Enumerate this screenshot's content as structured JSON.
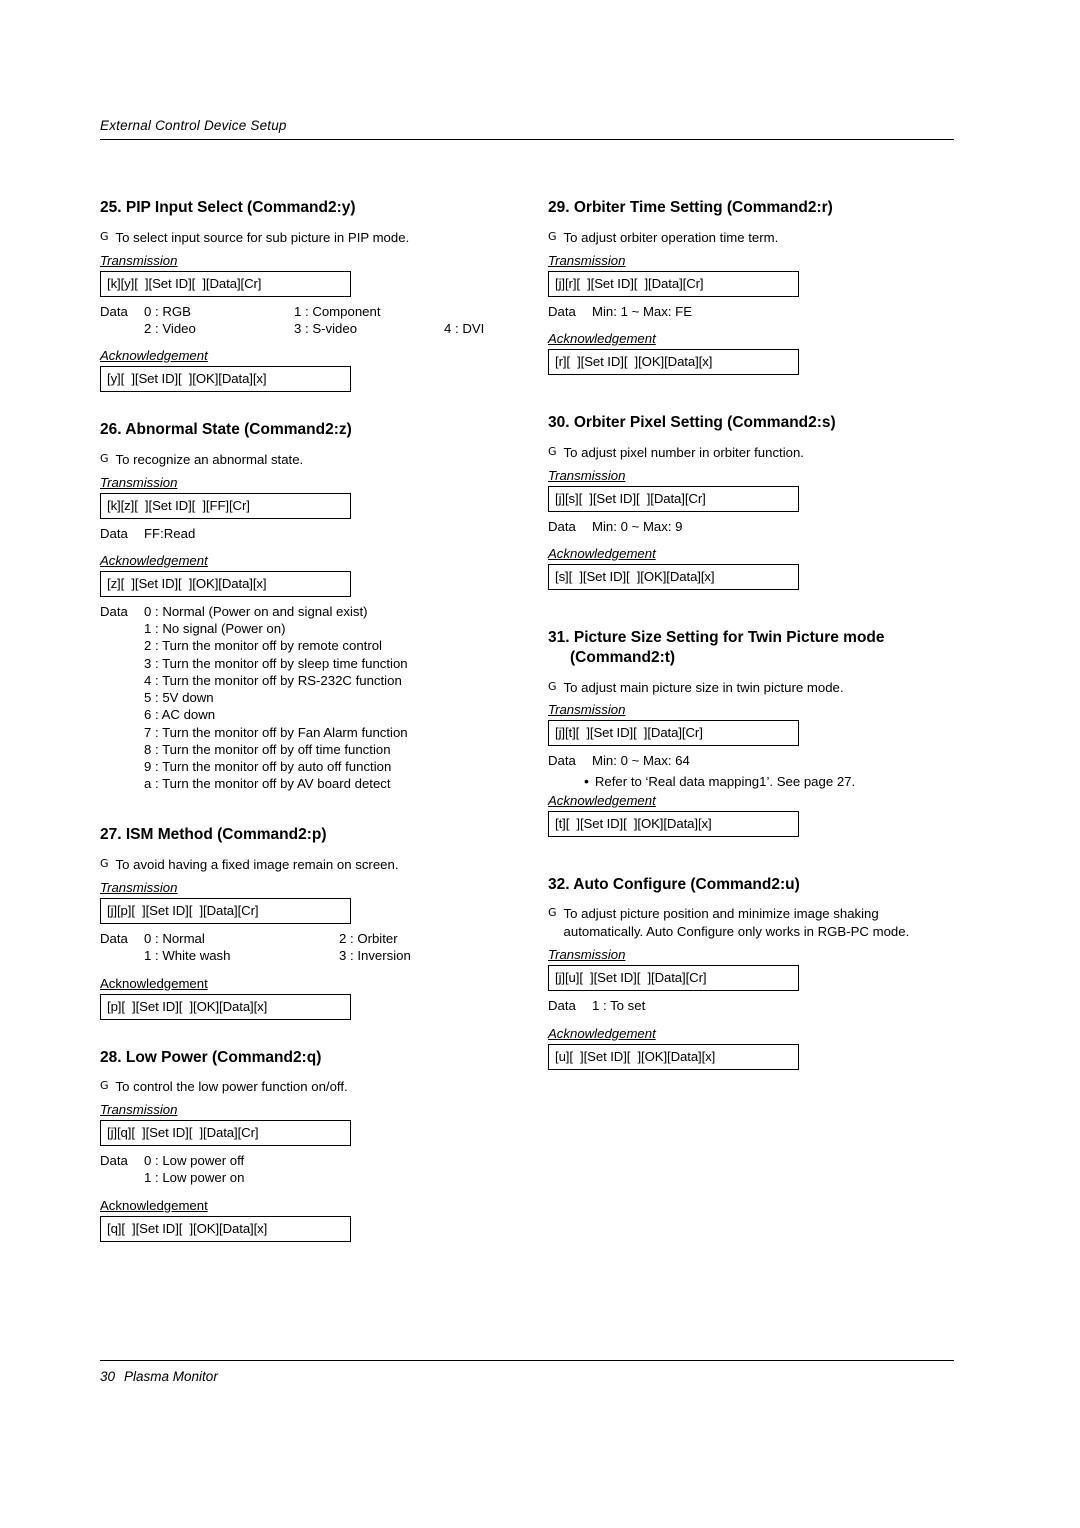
{
  "header": {
    "title": "External Control Device Setup"
  },
  "footer": {
    "page_number": "30",
    "text": "Plasma Monitor"
  },
  "labels": {
    "transmission": "Transmission",
    "acknowledgement": "Acknowledgement",
    "data": "Data",
    "bullet": "G",
    "dot": "•"
  },
  "left": {
    "s25": {
      "title_num": "25.",
      "title_text": "PIP Input Select (Command2:y)",
      "desc": "To select input source for sub picture in PIP mode.",
      "transmission": "[k][y][  ][Set ID][  ][Data][Cr]",
      "data_rows": [
        {
          "key": "Data",
          "c1": "0 : RGB",
          "c2": "1 : Component",
          "c3": ""
        },
        {
          "key": "",
          "c1": "2 : Video",
          "c2": "3 : S-video",
          "c3": "4 : DVI"
        }
      ],
      "acknowledgement": "[y][  ][Set ID][  ][OK][Data][x]"
    },
    "s26": {
      "title_num": "26.",
      "title_text": "Abnormal State (Command2:z)",
      "desc": "To recognize an abnormal state.",
      "transmission": "[k][z][  ][Set ID][  ][FF][Cr]",
      "data_line": {
        "key": "Data",
        "value": "FF:Read"
      },
      "acknowledgement": "[z][  ][Set ID][  ][OK][Data][x]",
      "data_list_key": "Data",
      "data_list": [
        "0 : Normal (Power on and signal exist)",
        "1 : No signal (Power on)",
        "2 : Turn the monitor off by remote control",
        "3 : Turn the monitor off by sleep time function",
        "4 : Turn the monitor off by RS-232C function",
        "5 : 5V down",
        "6 : AC down",
        "7 : Turn the monitor off by Fan Alarm function",
        "8 : Turn the monitor off by off time function",
        "9 : Turn the monitor off by auto off function",
        "a : Turn the monitor off by AV board detect"
      ]
    },
    "s27": {
      "title_num": "27.",
      "title_text": "ISM Method (Command2:p)",
      "desc": "To avoid having a fixed image remain on screen.",
      "transmission": "[j][p][  ][Set ID][  ][Data][Cr]",
      "data_rows": [
        {
          "key": "Data",
          "c1": "0 : Normal",
          "c2": "2 : Orbiter"
        },
        {
          "key": "",
          "c1": "1 : White wash",
          "c2": "3 : Inversion"
        }
      ],
      "acknowledgement": "[p][  ][Set ID][  ][OK][Data][x]"
    },
    "s28": {
      "title_num": "28.",
      "title_text": "Low Power (Command2:q)",
      "desc": "To control the low power function on/off.",
      "transmission": "[j][q][  ][Set ID][  ][Data][Cr]",
      "data_rows": [
        {
          "key": "Data",
          "c1": "0 : Low power off"
        },
        {
          "key": "",
          "c1": "1 : Low power on"
        }
      ],
      "acknowledgement": "[q][  ][Set ID][  ][OK][Data][x]"
    }
  },
  "right": {
    "s29": {
      "title_num": "29.",
      "title_text": "Orbiter Time Setting (Command2:r)",
      "desc": "To adjust orbiter operation time term.",
      "transmission": "[j][r][  ][Set ID][  ][Data][Cr]",
      "data_line": {
        "key": "Data",
        "value": "Min: 1 ~ Max: FE"
      },
      "acknowledgement": "[r][  ][Set ID][  ][OK][Data][x]"
    },
    "s30": {
      "title_num": "30.",
      "title_text": "Orbiter Pixel Setting (Command2:s)",
      "desc": "To adjust pixel number in orbiter function.",
      "transmission": "[j][s][  ][Set ID][  ][Data][Cr]",
      "data_line": {
        "key": "Data",
        "value": "Min: 0 ~ Max: 9"
      },
      "acknowledgement": "[s][  ][Set ID][  ][OK][Data][x]"
    },
    "s31": {
      "title_num": "31.",
      "title_text": "Picture Size Setting for Twin Picture mode",
      "title_cont": "(Command2:t)",
      "desc": "To adjust main picture size in twin picture mode.",
      "transmission": "[j][t][  ][Set ID][  ][Data][Cr]",
      "data_line": {
        "key": "Data",
        "value": "Min: 0 ~ Max: 64"
      },
      "note": "Refer to ‘Real data mapping1’. See page 27.",
      "acknowledgement": "[t][  ][Set ID][  ][OK][Data][x]"
    },
    "s32": {
      "title_num": "32.",
      "title_text": "Auto Configure (Command2:u)",
      "desc": "To adjust picture position and minimize image shaking automatically. Auto Configure only works in RGB-PC mode.",
      "transmission": "[j][u][  ][Set ID][  ][Data][Cr]",
      "data_line": {
        "key": "Data",
        "value": "1 : To set"
      },
      "acknowledgement": "[u][  ][Set ID][  ][OK][Data][x]"
    }
  }
}
